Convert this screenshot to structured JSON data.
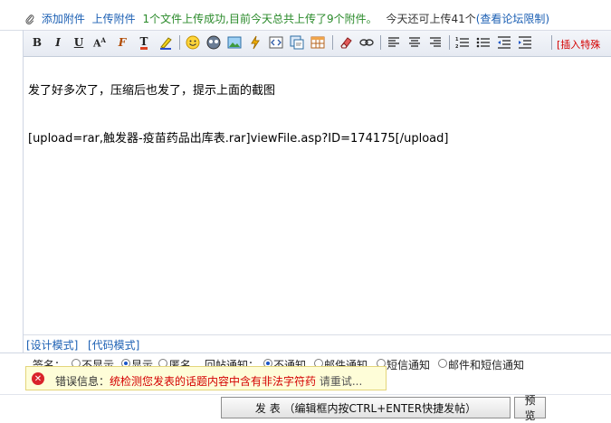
{
  "attach": {
    "add_attachment": "添加附件",
    "upload_attachment": "上传附件",
    "status": "1个文件上传成功,目前今天总共上传了9个附件。",
    "remaining": "今天还可上传41个",
    "view_limit": "(查看论坛限制)"
  },
  "toolbar": {
    "insert_special_label": "[插入特殊",
    "buttons": [
      "bold-icon",
      "italic-icon",
      "underline-icon",
      "font-size-icon",
      "font-face-icon",
      "font-color-icon",
      "highlight-icon",
      "emoticon-icon",
      "media-icon",
      "image-icon",
      "flash-icon",
      "code-icon",
      "quote-icon",
      "table-icon",
      "eraser-icon",
      "link-icon",
      "align-left-icon",
      "align-center-icon",
      "align-right-icon",
      "ordered-list-icon",
      "unordered-list-icon",
      "outdent-icon",
      "indent-icon"
    ]
  },
  "editor": {
    "line1": "发了好多次了，压缩后也发了，提示上面的截图",
    "line2": "[upload=rar,触发器-疫苗药品出库表.rar]viewFile.asp?ID=174175[/upload]"
  },
  "mode": {
    "design": "[设计模式]",
    "code": "[代码模式]"
  },
  "options": {
    "signature_label": "签名：",
    "hide": "不显示",
    "show": "显示",
    "anonymous": "匿名",
    "reply_notify_label": "回帖通知：",
    "no_notify": "不通知",
    "email_notify": "邮件通知",
    "sms_notify": "短信通知",
    "email_sms_notify": "邮件和短信通知"
  },
  "error": {
    "prefix": "错误信息：",
    "message": "统检测您发表的话题内容中含有非法字符药",
    "suffix": " 请重试..."
  },
  "buttons": {
    "submit": "发 表 （编辑框内按CTRL+ENTER快捷发帖）",
    "preview": "预 览"
  },
  "colors": {
    "link": "#1b5fb3",
    "success_text": "#2a8a2a",
    "error_text": "#d40000",
    "tooltip_bg": "#fefdd8"
  }
}
